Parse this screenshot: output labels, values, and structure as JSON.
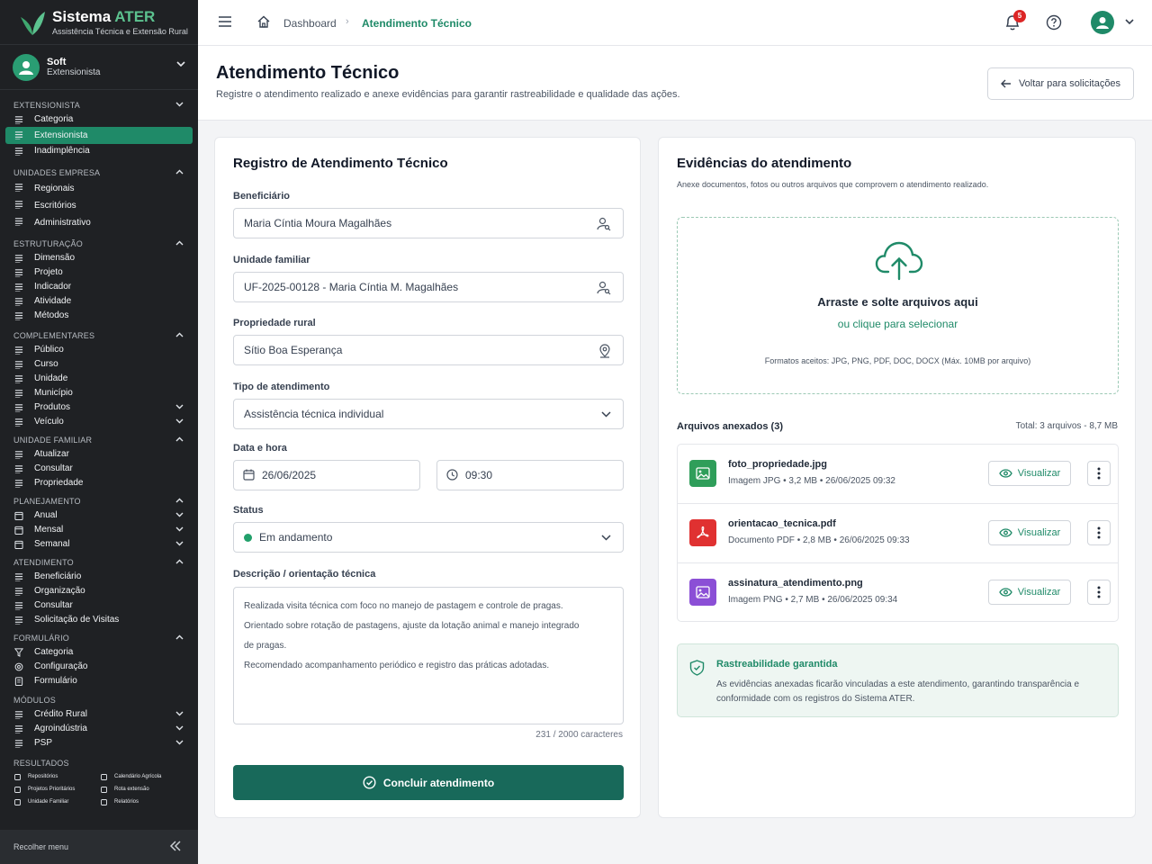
{
  "brand": {
    "name_a": "Sistema ",
    "name_b": "ATER",
    "subtitle": "Assistência Técnica e Extensão Rural"
  },
  "user": {
    "name": "Soft",
    "role": "Extensionista"
  },
  "sidebar": {
    "extensionista": {
      "title": "EXTENSIONISTA",
      "items": [
        "Categoria",
        "Extensionista",
        "Inadimplência"
      ]
    },
    "unidades": {
      "title": "UNIDADES EMPRESA",
      "items": [
        "Regionais",
        "Escritórios",
        "Administrativo"
      ]
    },
    "estruturacao": {
      "title": "ESTRUTURAÇÃO",
      "items": [
        "Dimensão",
        "Projeto",
        "Indicador",
        "Atividade",
        "Métodos"
      ]
    },
    "complementares": {
      "title": "COMPLEMENTARES",
      "items": [
        "Público",
        "Curso",
        "Unidade",
        "Município",
        "Produtos",
        "Veículo"
      ]
    },
    "unidade_familiar": {
      "title": "UNIDADE FAMILIAR",
      "items": [
        "Atualizar",
        "Consultar",
        "Propriedade"
      ]
    },
    "planejamento": {
      "title": "PLANEJAMENTO",
      "items": [
        "Anual",
        "Mensal",
        "Semanal"
      ]
    },
    "atendimento": {
      "title": "ATENDIMENTO",
      "items": [
        "Beneficiário",
        "Organização",
        "Consultar",
        "Solicitação de Visitas"
      ]
    },
    "formulario": {
      "title": "FORMULÁRIO",
      "items": [
        "Categoria",
        "Configuração",
        "Formulário"
      ]
    },
    "modulos": {
      "title": "MÓDULOS",
      "items": [
        "Crédito Rural",
        "Agroindústria",
        "PSP"
      ]
    },
    "resultados": {
      "title": "RESULTADOS",
      "items": [
        "Repositórios",
        "Calendário Agrícola",
        "Projetos Prioritários",
        "Rota extensão",
        "Unidade Familiar",
        "Relatórios"
      ]
    },
    "collapse_label": "Recolher menu"
  },
  "topbar": {
    "crumb_home": "Dashboard",
    "crumb_current": "Atendimento Técnico",
    "notifications": "5"
  },
  "page": {
    "title": "Atendimento Técnico",
    "subtitle": "Registre o atendimento realizado e anexe evidências para garantir rastreabilidade e qualidade das ações.",
    "back_label": "Voltar para solicitações"
  },
  "form": {
    "title": "Registro de Atendimento Técnico",
    "beneficiario_label": "Beneficiário",
    "beneficiario_value": "Maria Cíntia Moura Magalhães",
    "unidade_label": "Unidade familiar",
    "unidade_value": "UF-2025-00128 - Maria Cíntia M. Magalhães",
    "propriedade_label": "Propriedade rural",
    "propriedade_value": "Sítio Boa Esperança",
    "tipo_label": "Tipo de atendimento",
    "tipo_value": "Assistência técnica individual",
    "data_label": "Data e hora",
    "date_value": "26/06/2025",
    "time_value": "09:30",
    "status_label": "Status",
    "status_value": "Em andamento",
    "status_color": "#22a06b",
    "desc_label": "Descrição / orientação técnica",
    "desc_lines": [
      "Realizada visita técnica com foco no manejo de pastagem e controle de pragas.",
      "Orientado sobre rotação de pastagens, ajuste da lotação animal e manejo integrado",
      "de pragas.",
      "Recomendado acompanhamento periódico e registro das práticas adotadas."
    ],
    "counter": "231 / 2000 caracteres",
    "submit_label": "Concluir atendimento"
  },
  "evidence": {
    "title": "Evidências do atendimento",
    "subtitle": "Anexe documentos, fotos ou outros arquivos que comprovem o atendimento realizado.",
    "drop_title": "Arraste e solte arquivos aqui",
    "drop_link": "ou clique para selecionar",
    "drop_formats": "Formatos aceitos: JPG, PNG, PDF, DOC, DOCX (Máx. 10MB por arquivo)",
    "attached_label": "Arquivos anexados (3)",
    "total_label": "Total: 3 arquivos - 8,7 MB",
    "view_label": "Visualizar",
    "files": [
      {
        "name": "foto_propriedade.jpg",
        "meta": "Imagem JPG  •  3,2 MB  •  26/06/2025 09:32",
        "color": "#2f9e5a",
        "icon": "image-icon"
      },
      {
        "name": "orientacao_tecnica.pdf",
        "meta": "Documento PDF  •  2,8 MB  •  26/06/2025 09:33",
        "color": "#e03131",
        "icon": "pdf-icon"
      },
      {
        "name": "assinatura_atendimento.png",
        "meta": "Imagem PNG  •  2,7 MB  •  26/06/2025 09:34",
        "color": "#8b4fd6",
        "icon": "image-icon"
      }
    ],
    "trace_title": "Rastreabilidade garantida",
    "trace_text": "As evidências anexadas ficarão vinculadas a este atendimento, garantindo transparência e conformidade com os registros do Sistema ATER."
  },
  "colors": {
    "accent": "#1f8a68",
    "sidebar_bg": "#1f2124",
    "primary_button": "#18695a"
  }
}
